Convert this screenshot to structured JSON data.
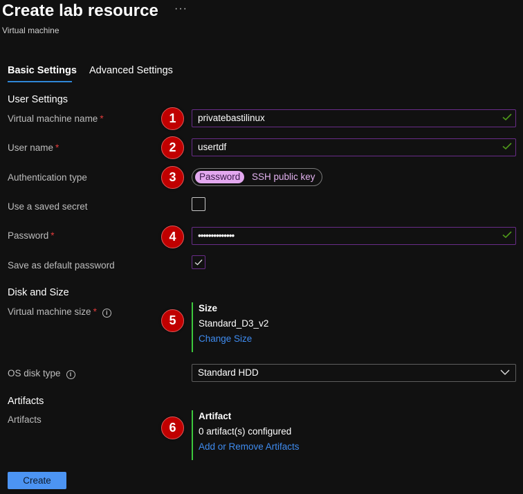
{
  "header": {
    "title": "Create lab resource",
    "more_label": "···",
    "subtitle": "Virtual machine"
  },
  "tabs": [
    {
      "label": "Basic Settings",
      "active": true
    },
    {
      "label": "Advanced Settings",
      "active": false
    }
  ],
  "sections": {
    "user_settings": "User Settings",
    "disk_and_size": "Disk and Size",
    "artifacts": "Artifacts"
  },
  "fields": {
    "vm_name": {
      "label": "Virtual machine name",
      "required": "*",
      "value": "privatebastilinux",
      "badge": "1",
      "valid": true
    },
    "user_name": {
      "label": "User name",
      "required": "*",
      "value": "usertdf",
      "badge": "2",
      "valid": true
    },
    "auth_type": {
      "label": "Authentication type",
      "badge": "3",
      "options": [
        "Password",
        "SSH public key"
      ],
      "selected": "Password"
    },
    "saved_secret": {
      "label": "Use a saved secret",
      "checked": false
    },
    "password": {
      "label": "Password",
      "required": "*",
      "value": "••••••••••••••",
      "badge": "4",
      "valid": true
    },
    "save_default": {
      "label": "Save as default password",
      "checked": true
    },
    "vm_size": {
      "label": "Virtual machine size",
      "required": "*",
      "badge": "5",
      "heading": "Size",
      "value": "Standard_D3_v2",
      "link": "Change Size"
    },
    "os_disk": {
      "label": "OS disk type",
      "value": "Standard HDD"
    },
    "artifacts": {
      "label": "Artifacts",
      "badge": "6",
      "heading": "Artifact",
      "value": "0 artifact(s) configured",
      "link": "Add or Remove Artifacts"
    }
  },
  "actions": {
    "create_label": "Create"
  },
  "colors": {
    "accent": "#4c94f3",
    "tab_underline": "#2f87d8",
    "input_border": "#6a2d8a",
    "valid_check": "#4f9a1a",
    "badge": "#c00000",
    "info_bar": "#3cc83c",
    "link": "#3f8cf0"
  }
}
